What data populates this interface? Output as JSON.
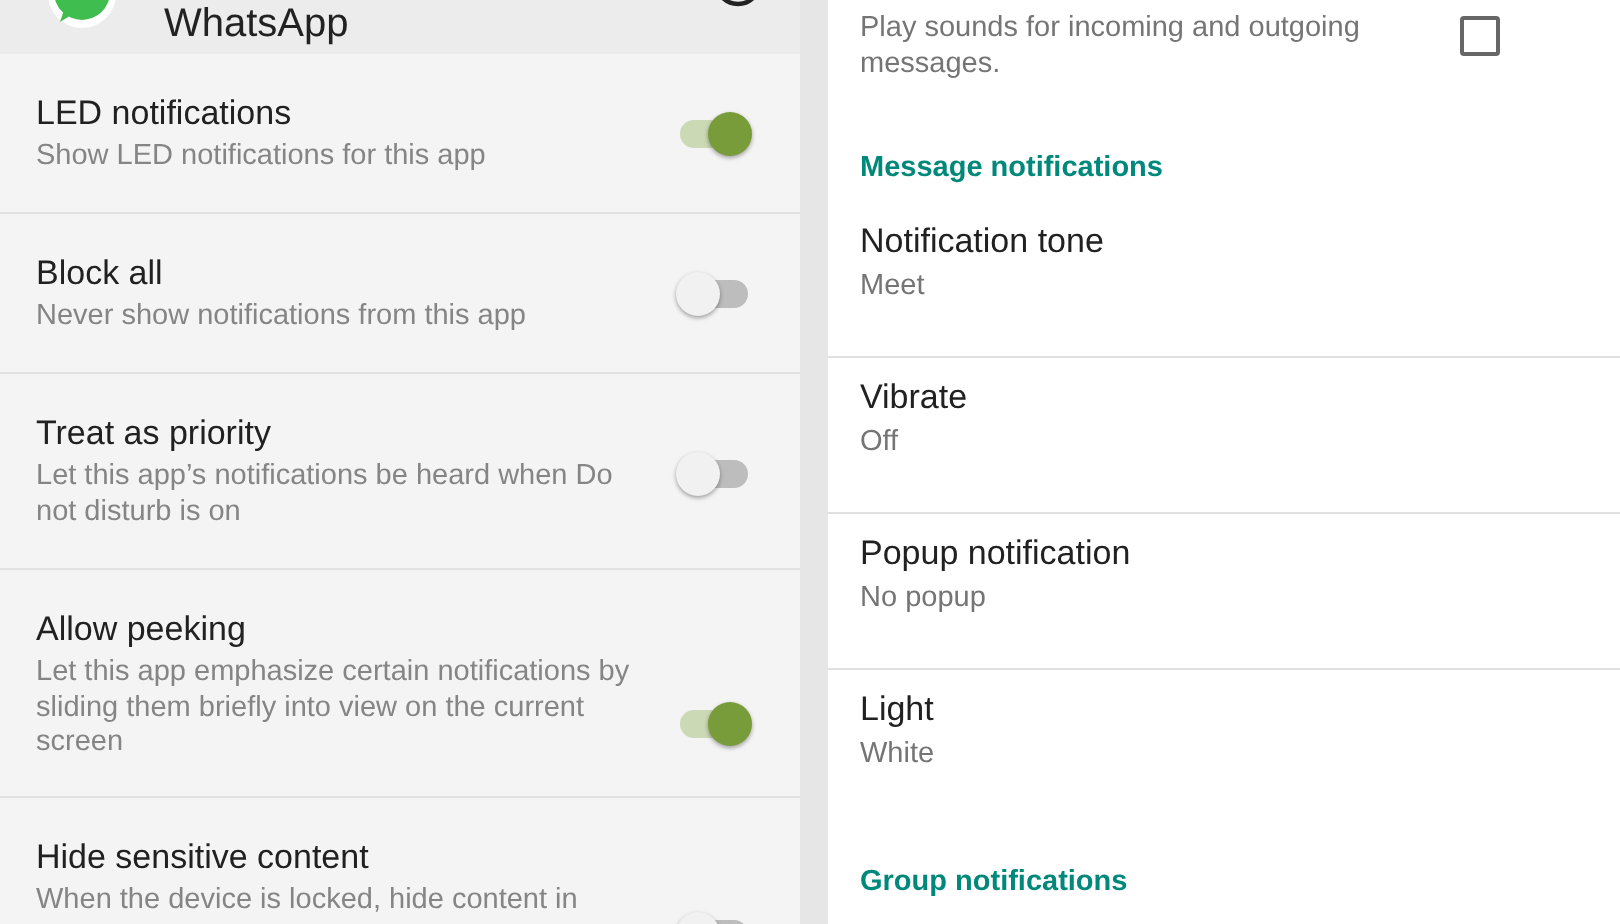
{
  "app_header": {
    "title": "WhatsApp"
  },
  "app_settings": [
    {
      "title": "LED notifications",
      "description": "Show LED notifications for this app",
      "on": true
    },
    {
      "title": "Block all",
      "description": "Never show notifications from this app",
      "on": false
    },
    {
      "title": "Treat as priority",
      "description": "Let this app’s notifications be heard when Do not disturb is on",
      "on": false
    },
    {
      "title": "Allow peeking",
      "description": "Let this app emphasize certain notifications by sliding them briefly into view on the current screen",
      "on": true
    },
    {
      "title": "Hide sensitive content",
      "description": "When the device is locked, hide content in",
      "on": false
    }
  ],
  "conversation_tones": {
    "description": "Play sounds for incoming and outgoing messages.",
    "checked": false
  },
  "sections": [
    {
      "title": "Message notifications",
      "items": [
        {
          "title": "Notification tone",
          "value": "Meet"
        },
        {
          "title": "Vibrate",
          "value": "Off"
        },
        {
          "title": "Popup notification",
          "value": "No popup"
        },
        {
          "title": "Light",
          "value": "White"
        }
      ]
    },
    {
      "title": "Group notifications"
    }
  ]
}
